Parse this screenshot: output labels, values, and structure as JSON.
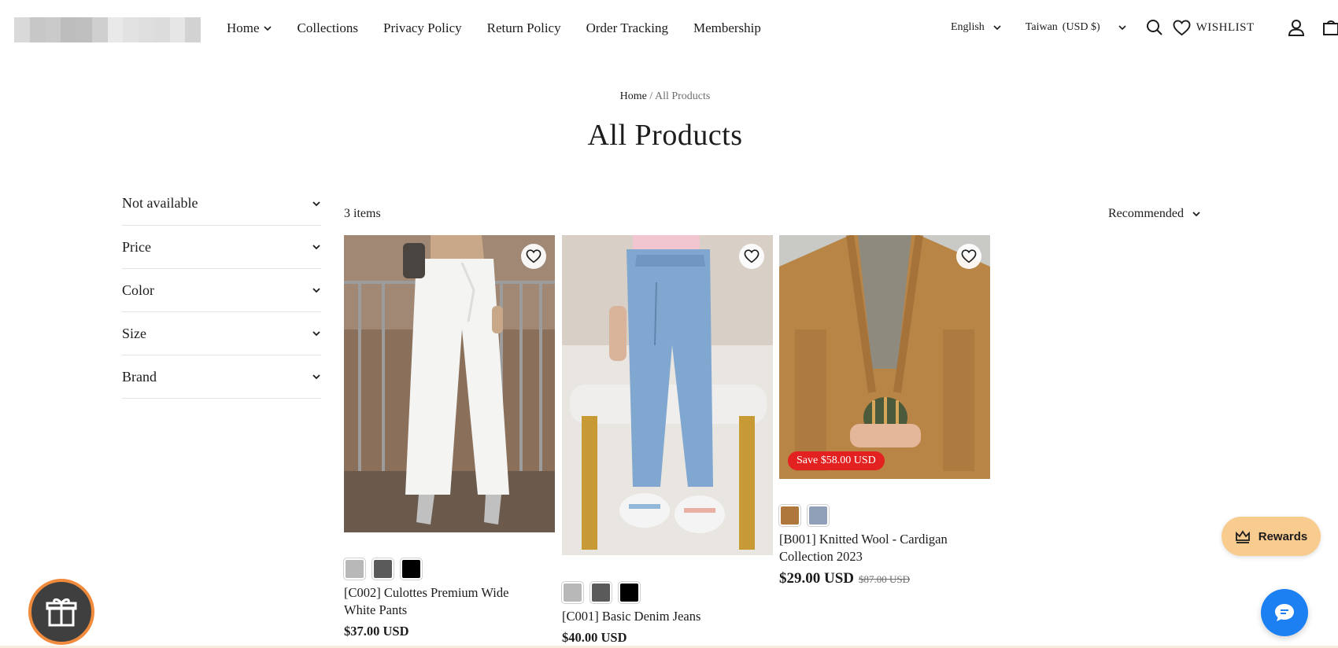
{
  "brand": {
    "logo_colors": [
      "#d9d9d9",
      "#cfcfcf",
      "#e6e6e6",
      "#bdbdbd",
      "#dedede",
      "#c7c7c7",
      "#e9e9e9",
      "#d2d2d2",
      "#bfbfbf",
      "#dcdcdc",
      "#cacaca",
      "#e2e2e2"
    ]
  },
  "nav": {
    "items": [
      {
        "label": "Home",
        "has_dropdown": true
      },
      {
        "label": "Collections"
      },
      {
        "label": "Privacy Policy"
      },
      {
        "label": "Return Policy"
      },
      {
        "label": "Order Tracking"
      },
      {
        "label": "Membership"
      }
    ]
  },
  "header": {
    "language": "English",
    "country": "Taiwan",
    "currency": "(USD $)",
    "wishlist_label": "WISHLIST",
    "icons": [
      "search-icon",
      "heart-icon",
      "account-icon",
      "cart-icon"
    ]
  },
  "breadcrumb": {
    "home": "Home",
    "separator": "/",
    "current": "All Products"
  },
  "page": {
    "title": "All Products"
  },
  "filters": [
    "Not available",
    "Price",
    "Color",
    "Size",
    "Brand"
  ],
  "toolbar": {
    "count": "3 items",
    "sort_label": "Recommended"
  },
  "products": [
    {
      "title_line1": "[C002] Culottes Premium Wide",
      "title_line2": "White Pants",
      "price": "$37.00 USD",
      "swatches": [
        "#b8b8b8",
        "#5a5a5a",
        "#000000"
      ]
    },
    {
      "title_line1": "[C001] Basic Denim Jeans",
      "title_line2": "",
      "price": "$40.00 USD",
      "swatches": [
        "#b8b8b8",
        "#5a5a5a",
        "#000000"
      ]
    },
    {
      "title_line1": "[B001] Knitted Wool - Cardigan",
      "title_line2": "Collection 2023",
      "price": "$29.00 USD",
      "compare_price": "$87.00 USD",
      "badge": "Save $58.00 USD",
      "swatches": [
        "#b0773c",
        "#8fa0b8"
      ]
    }
  ],
  "widgets": {
    "rewards_label": "Rewards"
  },
  "colors": {
    "accent_sale": "#e22120",
    "rewards_bg": "#f8cb8f",
    "chat_bg": "#1c7ff2",
    "gift_ring": "#f08a3c"
  }
}
